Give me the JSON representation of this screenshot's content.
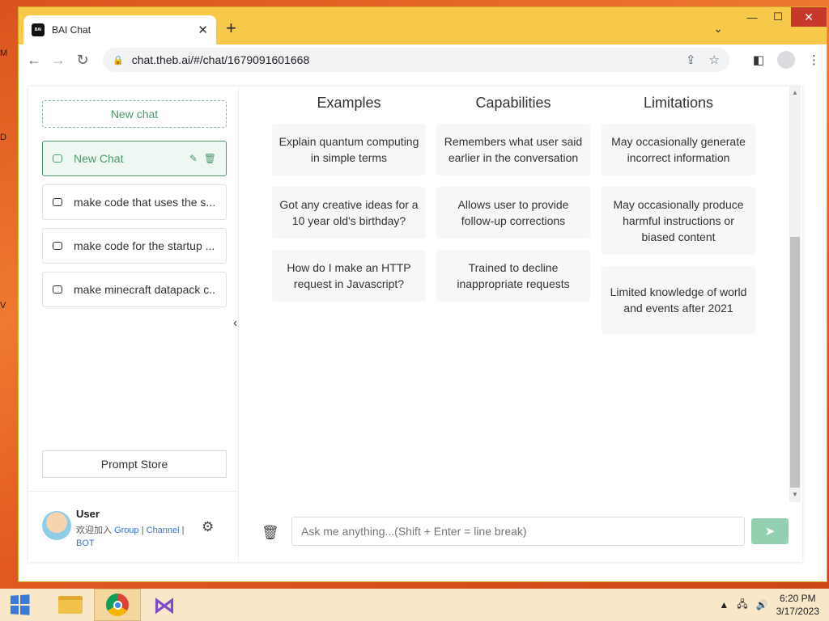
{
  "desktop": {
    "glyphs": [
      "M",
      "D",
      "V"
    ]
  },
  "browser": {
    "tab": {
      "title": "BAI Chat",
      "favicon": "BAI",
      "close": "✕"
    },
    "new_tab": "+",
    "window_controls": {
      "minimize": "—",
      "maximize": "☐",
      "close": "✕"
    },
    "tab_search": "⌄",
    "nav": {
      "back": "←",
      "forward": "→",
      "reload": "↻"
    },
    "url": "chat.theb.ai/#/chat/1679091601668",
    "icons": [
      "share-icon",
      "star-icon",
      "side-panel-icon",
      "profile-icon",
      "menu-icon"
    ]
  },
  "sidebar": {
    "new_chat": "New chat",
    "chats": [
      {
        "label": "New Chat",
        "active": true
      },
      {
        "label": "make code that uses the s..."
      },
      {
        "label": "make code for the startup ..."
      },
      {
        "label": "make minecraft datapack c..."
      }
    ],
    "prompt_store": "Prompt Store",
    "user": {
      "name": "User",
      "welcome": "欢迎加入",
      "links": [
        "Group",
        "Channel",
        "BOT"
      ]
    }
  },
  "main": {
    "columns": [
      {
        "title": "Examples",
        "cards": [
          "Explain quantum computing in simple terms",
          "Got any creative ideas for a 10 year old's birthday?",
          "How do I make an HTTP request in Javascript?"
        ]
      },
      {
        "title": "Capabilities",
        "cards": [
          "Remembers what user said earlier in the conversation",
          "Allows user to provide follow-up corrections",
          "Trained to decline inappropriate requests"
        ]
      },
      {
        "title": "Limitations",
        "cards": [
          "May occasionally generate incorrect information",
          "May occasionally produce harmful instructions or biased content",
          "Limited knowledge of world and events after 2021"
        ]
      }
    ],
    "input_placeholder": "Ask me anything...(Shift + Enter = line break)"
  },
  "taskbar": {
    "time": "6:20 PM",
    "date": "3/17/2023",
    "apps": [
      "file-explorer-icon",
      "chrome-icon",
      "visual-studio-icon"
    ]
  },
  "colors": {
    "accent": "#4e9a6e",
    "send_button": "#94d0b0",
    "link": "#3b73c5"
  }
}
